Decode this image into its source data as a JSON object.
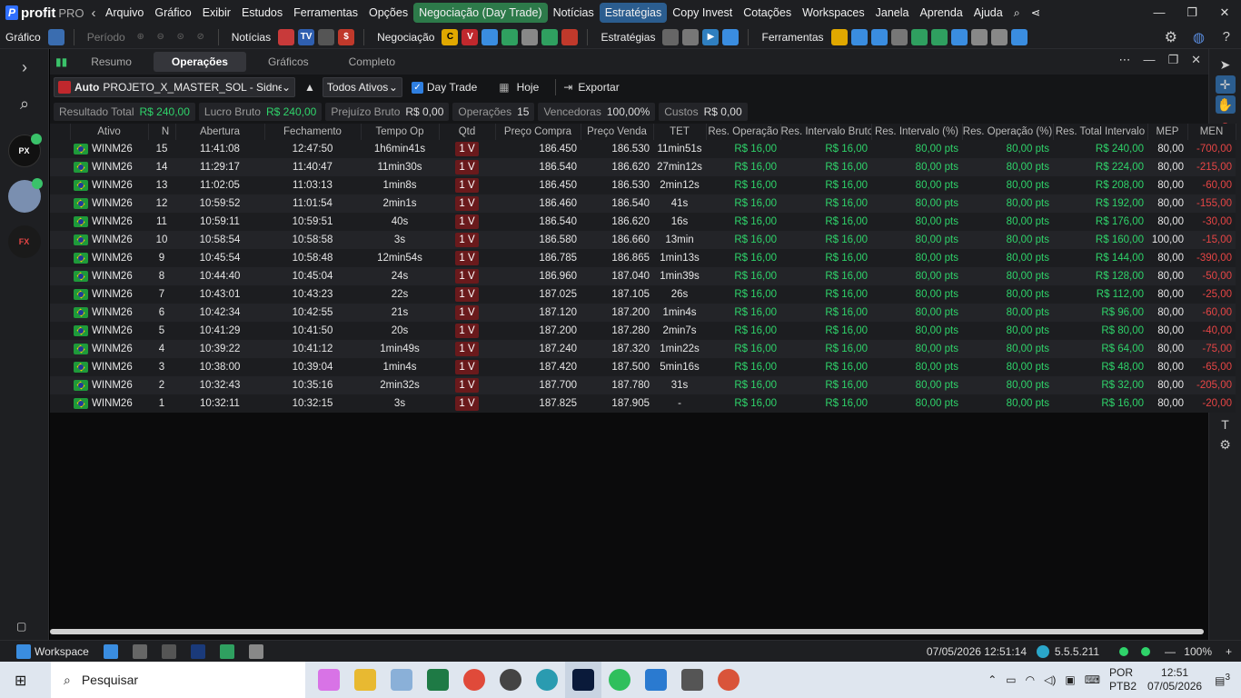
{
  "app": {
    "name": "profit",
    "suffix": "PRO"
  },
  "menu": [
    "Arquivo",
    "Gráfico",
    "Exibir",
    "Estudos",
    "Ferramentas",
    "Opções",
    "Negociação (Day Trade)",
    "Notícias",
    "Estratégias",
    "Copy Invest",
    "Cotações",
    "Workspaces",
    "Janela",
    "Aprenda",
    "Ajuda"
  ],
  "toolbar": {
    "grafico": "Gráfico",
    "periodo": "Período",
    "noticias": "Notícias",
    "negociacao": "Negociação",
    "estrategias": "Estratégias",
    "ferramentas": "Ferramentas"
  },
  "tabs": [
    "Resumo",
    "Operações",
    "Gráficos",
    "Completo"
  ],
  "filters": {
    "auto": "Auto",
    "account": "PROJETO_X_MASTER_SOL - Sidney Senc",
    "assets": "Todos Ativos",
    "daytrade": "Day Trade",
    "today": "Hoje",
    "export": "Exportar"
  },
  "summary": [
    {
      "label": "Resultado Total",
      "value": "R$ 240,00",
      "green": true
    },
    {
      "label": "Lucro Bruto",
      "value": "R$ 240,00",
      "green": true
    },
    {
      "label": "Prejuízo Bruto",
      "value": "R$ 0,00",
      "green": false
    },
    {
      "label": "Operações",
      "value": "15",
      "green": false
    },
    {
      "label": "Vencedoras",
      "value": "100,00%",
      "green": false
    },
    {
      "label": "Custos",
      "value": "R$ 0,00",
      "green": false
    }
  ],
  "columns": [
    "Ativo",
    "N",
    "Abertura",
    "Fechamento",
    "Tempo Op",
    "Qtd",
    "Preço Compra",
    "Preço Venda",
    "TET",
    "Res. Operação",
    "Res. Intervalo Bruto",
    "Res. Intervalo (%)",
    "Res. Operação (%)",
    "Res. Total Intervalo",
    "MEP",
    "MEN"
  ],
  "rows": [
    [
      "WINM26",
      "15",
      "11:41:08",
      "12:47:50",
      "1h6min41s",
      "1 V",
      "186.450",
      "186.530",
      "11min51s",
      "R$ 16,00",
      "R$ 16,00",
      "80,00 pts",
      "80,00 pts",
      "R$ 240,00",
      "80,00",
      "-700,00"
    ],
    [
      "WINM26",
      "14",
      "11:29:17",
      "11:40:47",
      "11min30s",
      "1 V",
      "186.540",
      "186.620",
      "27min12s",
      "R$ 16,00",
      "R$ 16,00",
      "80,00 pts",
      "80,00 pts",
      "R$ 224,00",
      "80,00",
      "-215,00"
    ],
    [
      "WINM26",
      "13",
      "11:02:05",
      "11:03:13",
      "1min8s",
      "1 V",
      "186.450",
      "186.530",
      "2min12s",
      "R$ 16,00",
      "R$ 16,00",
      "80,00 pts",
      "80,00 pts",
      "R$ 208,00",
      "80,00",
      "-60,00"
    ],
    [
      "WINM26",
      "12",
      "10:59:52",
      "11:01:54",
      "2min1s",
      "1 V",
      "186.460",
      "186.540",
      "41s",
      "R$ 16,00",
      "R$ 16,00",
      "80,00 pts",
      "80,00 pts",
      "R$ 192,00",
      "80,00",
      "-155,00"
    ],
    [
      "WINM26",
      "11",
      "10:59:11",
      "10:59:51",
      "40s",
      "1 V",
      "186.540",
      "186.620",
      "16s",
      "R$ 16,00",
      "R$ 16,00",
      "80,00 pts",
      "80,00 pts",
      "R$ 176,00",
      "80,00",
      "-30,00"
    ],
    [
      "WINM26",
      "10",
      "10:58:54",
      "10:58:58",
      "3s",
      "1 V",
      "186.580",
      "186.660",
      "13min",
      "R$ 16,00",
      "R$ 16,00",
      "80,00 pts",
      "80,00 pts",
      "R$ 160,00",
      "100,00",
      "-15,00"
    ],
    [
      "WINM26",
      "9",
      "10:45:54",
      "10:58:48",
      "12min54s",
      "1 V",
      "186.785",
      "186.865",
      "1min13s",
      "R$ 16,00",
      "R$ 16,00",
      "80,00 pts",
      "80,00 pts",
      "R$ 144,00",
      "80,00",
      "-390,00"
    ],
    [
      "WINM26",
      "8",
      "10:44:40",
      "10:45:04",
      "24s",
      "1 V",
      "186.960",
      "187.040",
      "1min39s",
      "R$ 16,00",
      "R$ 16,00",
      "80,00 pts",
      "80,00 pts",
      "R$ 128,00",
      "80,00",
      "-50,00"
    ],
    [
      "WINM26",
      "7",
      "10:43:01",
      "10:43:23",
      "22s",
      "1 V",
      "187.025",
      "187.105",
      "26s",
      "R$ 16,00",
      "R$ 16,00",
      "80,00 pts",
      "80,00 pts",
      "R$ 112,00",
      "80,00",
      "-25,00"
    ],
    [
      "WINM26",
      "6",
      "10:42:34",
      "10:42:55",
      "21s",
      "1 V",
      "187.120",
      "187.200",
      "1min4s",
      "R$ 16,00",
      "R$ 16,00",
      "80,00 pts",
      "80,00 pts",
      "R$ 96,00",
      "80,00",
      "-60,00"
    ],
    [
      "WINM26",
      "5",
      "10:41:29",
      "10:41:50",
      "20s",
      "1 V",
      "187.200",
      "187.280",
      "2min7s",
      "R$ 16,00",
      "R$ 16,00",
      "80,00 pts",
      "80,00 pts",
      "R$ 80,00",
      "80,00",
      "-40,00"
    ],
    [
      "WINM26",
      "4",
      "10:39:22",
      "10:41:12",
      "1min49s",
      "1 V",
      "187.240",
      "187.320",
      "1min22s",
      "R$ 16,00",
      "R$ 16,00",
      "80,00 pts",
      "80,00 pts",
      "R$ 64,00",
      "80,00",
      "-75,00"
    ],
    [
      "WINM26",
      "3",
      "10:38:00",
      "10:39:04",
      "1min4s",
      "1 V",
      "187.420",
      "187.500",
      "5min16s",
      "R$ 16,00",
      "R$ 16,00",
      "80,00 pts",
      "80,00 pts",
      "R$ 48,00",
      "80,00",
      "-65,00"
    ],
    [
      "WINM26",
      "2",
      "10:32:43",
      "10:35:16",
      "2min32s",
      "1 V",
      "187.700",
      "187.780",
      "31s",
      "R$ 16,00",
      "R$ 16,00",
      "80,00 pts",
      "80,00 pts",
      "R$ 32,00",
      "80,00",
      "-205,00"
    ],
    [
      "WINM26",
      "1",
      "10:32:11",
      "10:32:15",
      "3s",
      "1 V",
      "187.825",
      "187.905",
      "-",
      "R$ 16,00",
      "R$ 16,00",
      "80,00 pts",
      "80,00 pts",
      "R$ 16,00",
      "80,00",
      "-20,00"
    ]
  ],
  "statusbar": {
    "workspace": "Workspace",
    "datetime": "07/05/2026 12:51:14",
    "version": "5.5.5.211",
    "zoom": "100%"
  },
  "taskbar": {
    "search": "Pesquisar",
    "lang": "POR",
    "kbd": "PTB2",
    "time": "12:51",
    "date": "07/05/2026",
    "notif": "3"
  },
  "colors": {
    "green": "#2fd36a",
    "red": "#e64545",
    "accent": "#2b5d8f"
  }
}
